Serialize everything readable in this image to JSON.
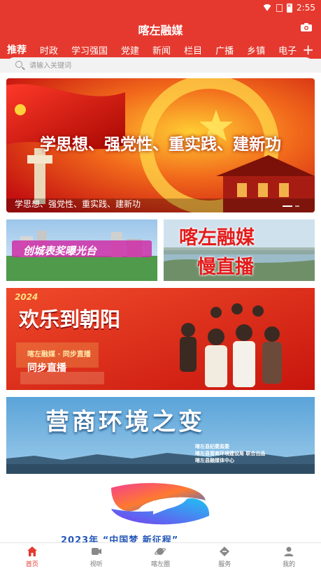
{
  "status": {
    "time": "2:55"
  },
  "header": {
    "title": "喀左融媒"
  },
  "tabs": [
    "推荐",
    "时政",
    "学习强国",
    "党建",
    "新闻",
    "栏目",
    "广播",
    "乡镇",
    "电子"
  ],
  "search": {
    "placeholder": "请输入关键词"
  },
  "hero": {
    "headline": "学思想、强党性、重实践、建新功",
    "caption": "学思想、强党性、重实践、建新功"
  },
  "tiles": {
    "left_small": {
      "text": "创城表奖曝光台"
    },
    "right_small": {
      "line1": "喀左融媒",
      "line2": "慢直播"
    },
    "banner1": {
      "year": "2024",
      "title": "欢乐到朝阳",
      "sub": "喀左融媒 · 同步直播",
      "live": "同步直播"
    },
    "banner2": {
      "title": "营商环境之变",
      "credit1": "喀左县纪委监委",
      "credit2": "喀左县营商环境建设局 联合出品",
      "credit3": "喀左县融媒体中心"
    },
    "banner3": {
      "text": "2023年 “中国梦 新征程”"
    }
  },
  "bottom_nav": [
    {
      "label": "首页",
      "icon": "home-icon",
      "active": true
    },
    {
      "label": "视听",
      "icon": "video-icon",
      "active": false
    },
    {
      "label": "喀左圈",
      "icon": "planet-icon",
      "active": false
    },
    {
      "label": "服务",
      "icon": "service-icon",
      "active": false
    },
    {
      "label": "我的",
      "icon": "user-icon",
      "active": false
    }
  ],
  "colors": {
    "brand": "#e5392f"
  }
}
